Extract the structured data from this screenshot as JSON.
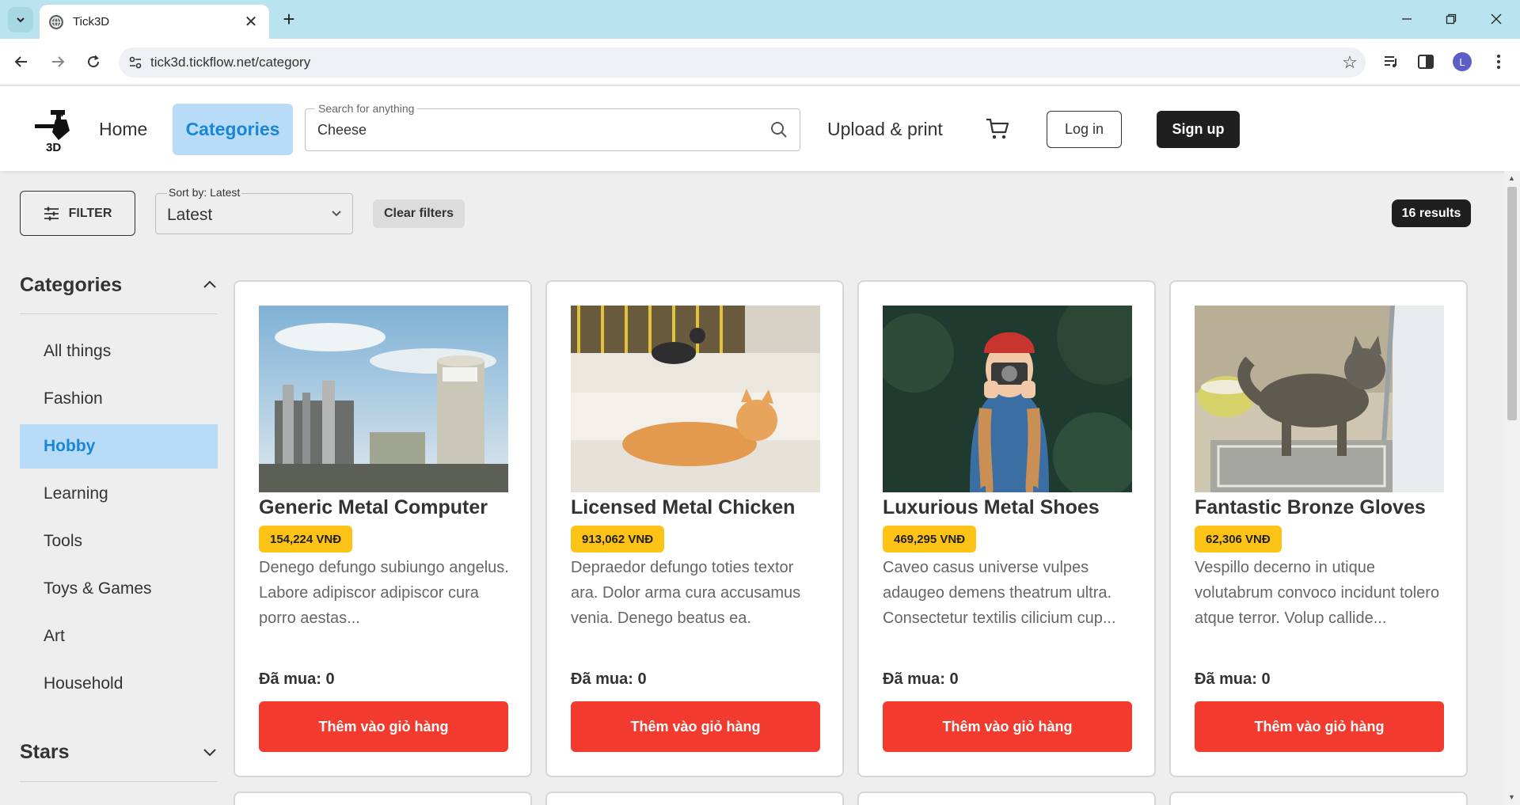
{
  "browser": {
    "tab_title": "Tick3D",
    "url": "tick3d.tickflow.net/category",
    "profile_initial": "L"
  },
  "header": {
    "nav_home": "Home",
    "nav_categories": "Categories",
    "search": {
      "legend": "Search for anything",
      "value": "Cheese"
    },
    "upload": "Upload & print",
    "login": "Log in",
    "signup": "Sign up",
    "logo_text": "3D"
  },
  "toolbar": {
    "filter_label": "FILTER",
    "sort_legend": "Sort by: Latest",
    "sort_value": "Latest",
    "clear_label": "Clear filters",
    "results": "16 results"
  },
  "sidebar": {
    "categories_heading": "Categories",
    "items": [
      {
        "label": "All things"
      },
      {
        "label": "Fashion"
      },
      {
        "label": "Hobby",
        "active": true
      },
      {
        "label": "Learning"
      },
      {
        "label": "Tools"
      },
      {
        "label": "Toys & Games"
      },
      {
        "label": "Art"
      },
      {
        "label": "Household"
      }
    ],
    "stars_heading": "Stars"
  },
  "products": [
    {
      "title": "Generic Metal Computer",
      "price": "154,224 VNĐ",
      "description": "Denego defungo subiungo angelus. Labore adipiscor adipiscor cura porro aestas...",
      "bought": "Đã mua: 0",
      "button": "Thêm vào giỏ hàng"
    },
    {
      "title": "Licensed Metal Chicken",
      "price": "913,062 VNĐ",
      "description": "Depraedor defungo toties textor ara. Dolor arma cura accusamus venia. Denego beatus ea.",
      "bought": "Đã mua: 0",
      "button": "Thêm vào giỏ hàng"
    },
    {
      "title": "Luxurious Metal Shoes",
      "price": "469,295 VNĐ",
      "description": "Caveo casus universe vulpes adaugeo demens theatrum ultra. Consectetur textilis cilicium cup...",
      "bought": "Đã mua: 0",
      "button": "Thêm vào giỏ hàng"
    },
    {
      "title": "Fantastic Bronze Gloves",
      "price": "62,306 VNĐ",
      "description": "Vespillo decerno in utique volutabrum convoco incidunt tolero atque terror. Volup callide...",
      "bought": "Đã mua: 0",
      "button": "Thêm vào giỏ hàng"
    }
  ],
  "colors": {
    "accent_blue": "#1b86d6",
    "active_bg": "#b8dcf7",
    "price_yellow": "#fdc317",
    "cta_red": "#f23b2e",
    "dark": "#1f1f1f"
  }
}
